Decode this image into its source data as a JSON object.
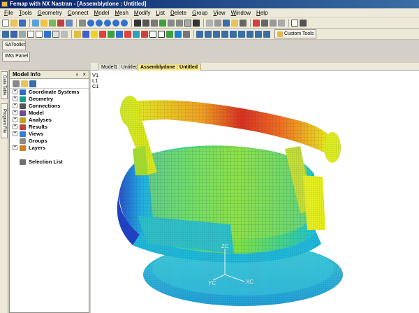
{
  "window": {
    "title": "Femap with NX Nastran - [Assemblydone : Untitled]"
  },
  "menu": [
    "File",
    "Tools",
    "Geometry",
    "Connect",
    "Model",
    "Mesh",
    "Modify",
    "List",
    "Delete",
    "Group",
    "View",
    "Window",
    "Help"
  ],
  "toolbar": {
    "custom_tools_label": "Custom Tools"
  },
  "panels": {
    "satoolkit": "SAToolkit",
    "img_panel": "IMG Panel"
  },
  "side_tabs": [
    "Data Table",
    "Program File"
  ],
  "model_info": {
    "title": "Model Info",
    "pin": "ᵻ",
    "close": "×",
    "items": [
      {
        "label": "Coordinate Systems",
        "expand": "+",
        "color": "#2b6cc4"
      },
      {
        "label": "Geometry",
        "expand": "+",
        "color": "#1b9a8a"
      },
      {
        "label": "Connections",
        "expand": "+",
        "color": "#555555"
      },
      {
        "label": "Model",
        "expand": "+",
        "color": "#6b4b9a"
      },
      {
        "label": "Analyses",
        "expand": "+",
        "color": "#c0a020"
      },
      {
        "label": "Results",
        "expand": "+",
        "color": "#c04040"
      },
      {
        "label": "Views",
        "expand": "+",
        "color": "#3b7bd0"
      },
      {
        "label": "Groups",
        "expand": "",
        "color": "#8a8a8a"
      },
      {
        "label": "Layers",
        "expand": "+",
        "color": "#d08020"
      },
      {
        "label": "",
        "expand": "",
        "color": ""
      },
      {
        "label": "Selection List",
        "expand": "",
        "color": "#707070"
      }
    ]
  },
  "tabs": [
    {
      "label": "Model1 : Untitled"
    },
    {
      "label": "Assemblydone : Untitled"
    }
  ],
  "viewport": {
    "labels": [
      "V1",
      "L1",
      "C1"
    ],
    "axes": {
      "x": "XC",
      "y": "YC",
      "z": "ZC"
    }
  }
}
